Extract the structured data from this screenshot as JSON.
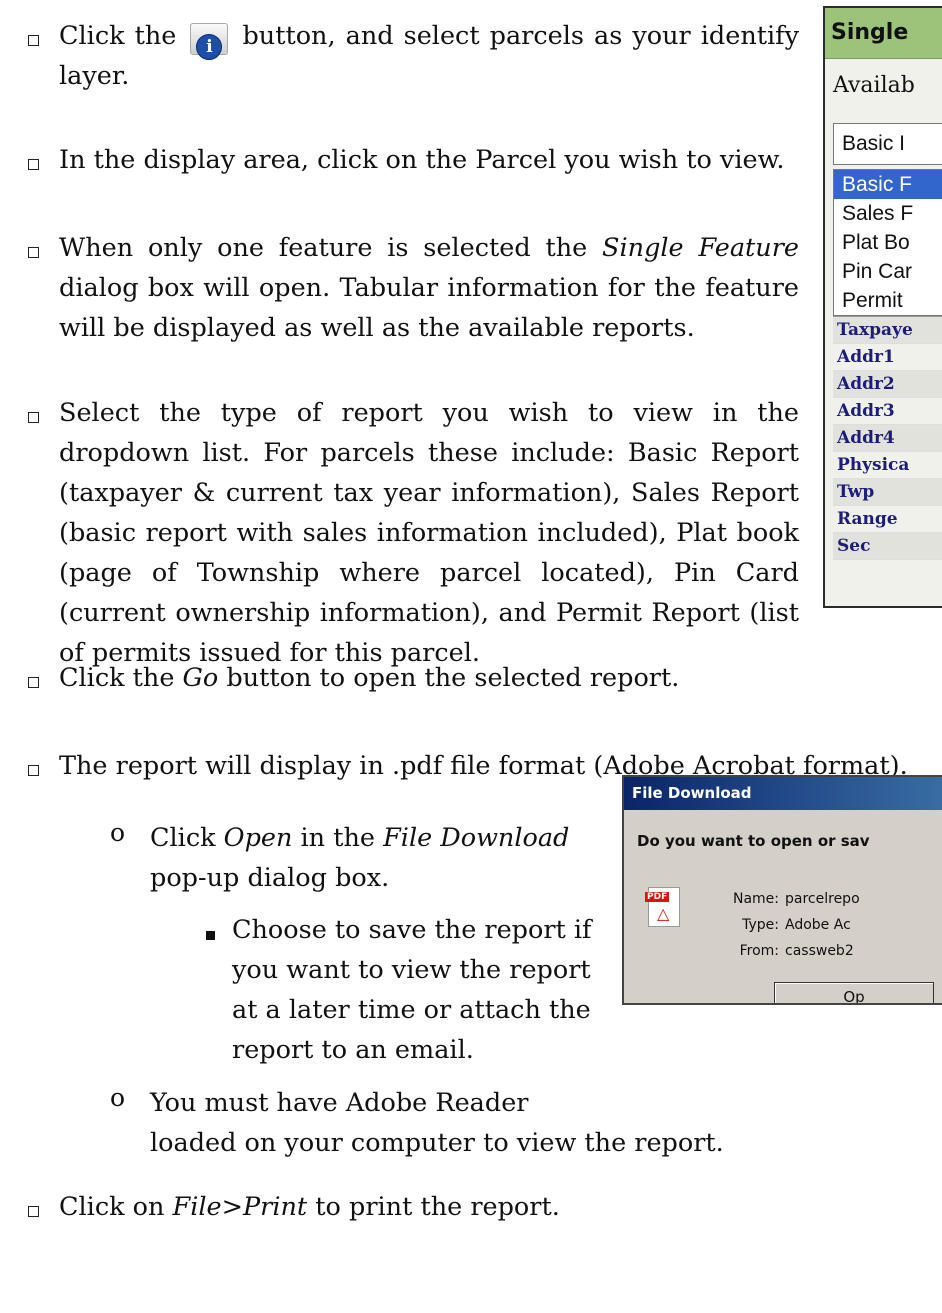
{
  "steps": [
    {
      "pre": "Click the",
      "post": "button, and select parcels as your identify layer."
    },
    {
      "text": "In the display area, click on the Parcel you wish to view."
    },
    {
      "pre": "When only one feature is selected the",
      "em": "Single Feature",
      "post": "dialog box will open.  Tabular information for the feature will be displayed as well as the available reports."
    },
    {
      "text": "Select the type of report you wish to view in the dropdown list.  For parcels these include: Basic Report (taxpayer & current tax year information), Sales Report (basic report with sales information included), Plat book (page of Township where parcel located), Pin Card (current ownership information), and Permit Report (list of permits issued for this parcel."
    },
    {
      "pre": "Click the",
      "em": "Go",
      "post": "button to open the selected report."
    },
    {
      "text": "The report will display in .pdf file format (Adobe Acrobat format)."
    },
    {
      "pre": "Click on",
      "em": "File>Print",
      "post": "to print the report."
    }
  ],
  "sub": {
    "open_pre": "Click",
    "open_em1": "Open",
    "open_mid": "in the",
    "open_em2": "File Download",
    "open_post": "pop-up dialog box.",
    "save_text": "Choose to save the report if you want to view the report at a later time or attach the report to an email.",
    "reader_line1": "You must have Adobe Reader",
    "reader_line2": "loaded on your computer to view the report."
  },
  "icons": {
    "info": "i",
    "circle_bullet": "o"
  },
  "single_feature": {
    "title": "Single",
    "available": "Availab",
    "dropdown_value": "Basic I",
    "options": [
      "Basic F",
      "Sales F",
      "Plat Bo",
      "Pin Car",
      "Permit"
    ],
    "attributes": [
      "Taxpaye",
      "Addr1",
      "Addr2",
      "Addr3",
      "Addr4",
      "Physica",
      "Twp",
      "Range",
      "Sec"
    ]
  },
  "file_download": {
    "title": "File Download",
    "question": "Do you want to open or sav",
    "name_label": "Name:",
    "name_value": "parcelrepo",
    "type_label": "Type:",
    "type_value": "Adobe Ac",
    "from_label": "From:",
    "from_value": "cassweb2",
    "open_button": "Op",
    "pdf_tag": "PDF",
    "pdf_brand": "Adobe"
  },
  "colors": {
    "panel_title_bg": "#9bc47a",
    "selected_option": "#3366cc",
    "dialog_titlebar": "#0a246a",
    "attr_text": "#1c1c7a"
  }
}
